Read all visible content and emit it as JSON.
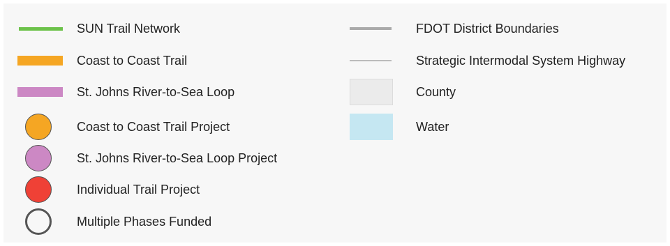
{
  "legend": {
    "left_items": [
      {
        "label": "SUN Trail Network",
        "symbol": "line",
        "color": "#6cc24a"
      },
      {
        "label": "Coast to Coast Trail",
        "symbol": "bar",
        "color": "#f5a623"
      },
      {
        "label": "St. Johns River-to-Sea Loop",
        "symbol": "bar",
        "color": "#cc88c4"
      },
      {
        "label": "Coast to Coast Trail Project",
        "symbol": "circle",
        "color": "#f5a623",
        "outline": "#444444"
      },
      {
        "label": "St. Johns River-to-Sea Loop Project",
        "symbol": "circle",
        "color": "#cc88c4",
        "outline": "#444444"
      },
      {
        "label": "Individual Trail Project",
        "symbol": "circle",
        "color": "#ef4136",
        "outline": "#444444"
      },
      {
        "label": "Multiple Phases Funded",
        "symbol": "hollow-circle",
        "color": "none",
        "outline": "#444444"
      }
    ],
    "right_items": [
      {
        "label": "FDOT District Boundaries",
        "symbol": "line-thick",
        "color": "#aaaaaa"
      },
      {
        "label": "Strategic Intermodal System Highway",
        "symbol": "line-thin",
        "color": "#bbbbbb"
      },
      {
        "label": "County",
        "symbol": "box",
        "color": "#ebebeb",
        "outline": "#dddddd"
      },
      {
        "label": "Water",
        "symbol": "box",
        "color": "#c5e7f2"
      }
    ]
  }
}
